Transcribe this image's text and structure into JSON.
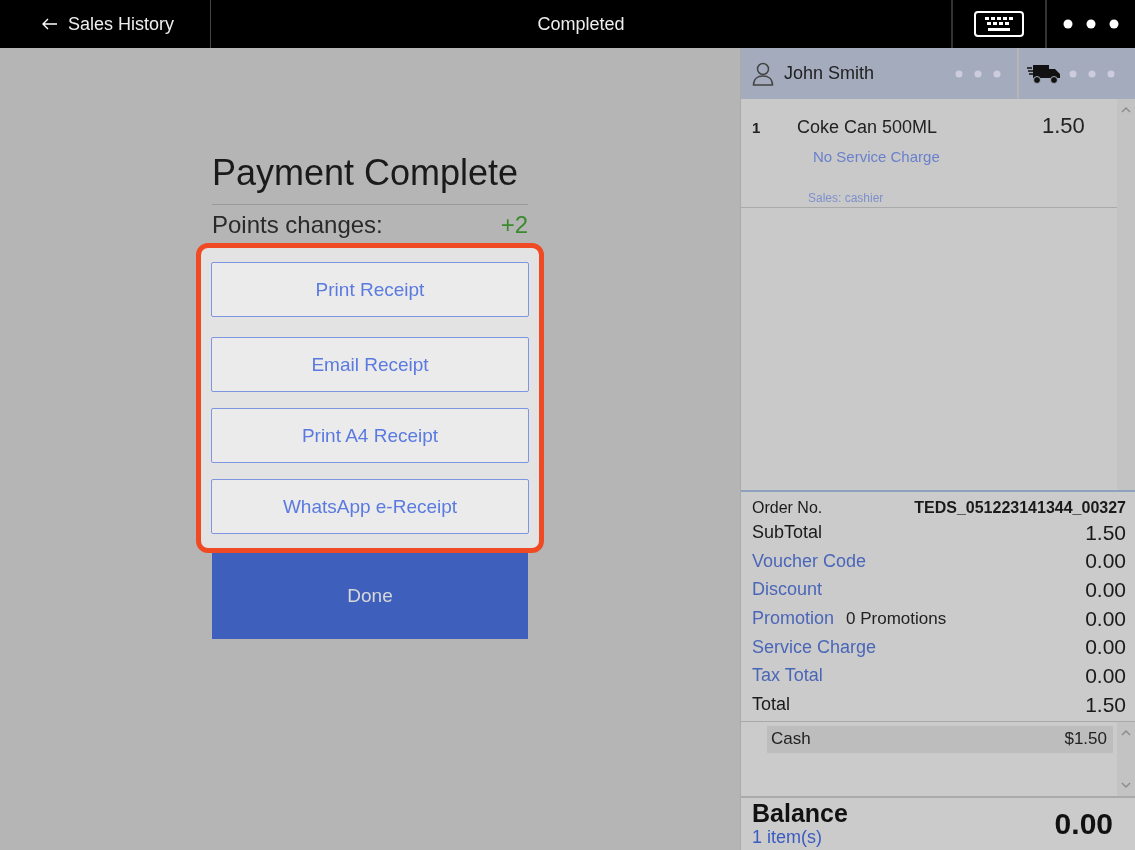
{
  "top_bar": {
    "back_label": "Sales History",
    "title": "Completed"
  },
  "payment": {
    "title": "Payment Complete",
    "points_label": "Points changes:",
    "points_value": "+2",
    "receipt_buttons": [
      "Print Receipt",
      "Email Receipt",
      "Print A4 Receipt",
      "WhatsApp e-Receipt"
    ],
    "done_button": "Done"
  },
  "order_panel": {
    "customer": "John Smith",
    "items": [
      {
        "qty": "1",
        "name": "Coke Can 500ML",
        "price": "1.50",
        "note": "No Service Charge",
        "sales": "Sales: cashier"
      }
    ],
    "order_no_label": "Order No.",
    "order_no": "TEDS_051223141344_00327",
    "summary": [
      {
        "kind": "plain",
        "label": "SubTotal",
        "value": "1.50"
      },
      {
        "kind": "link",
        "label": "Voucher Code",
        "value": "0.00"
      },
      {
        "kind": "link",
        "label": "Discount",
        "value": "0.00"
      },
      {
        "kind": "link",
        "label": "Promotion",
        "note": "0 Promotions",
        "value": "0.00"
      },
      {
        "kind": "link",
        "label": "Service Charge",
        "value": "0.00"
      },
      {
        "kind": "link",
        "label": "Tax Total",
        "value": "0.00"
      },
      {
        "kind": "plain",
        "label": "Total",
        "value": "1.50"
      }
    ],
    "payments": [
      {
        "method": "Cash",
        "amount": "$1.50"
      }
    ],
    "balance_label": "Balance",
    "item_count": "1 item(s)",
    "balance": "0.00"
  }
}
